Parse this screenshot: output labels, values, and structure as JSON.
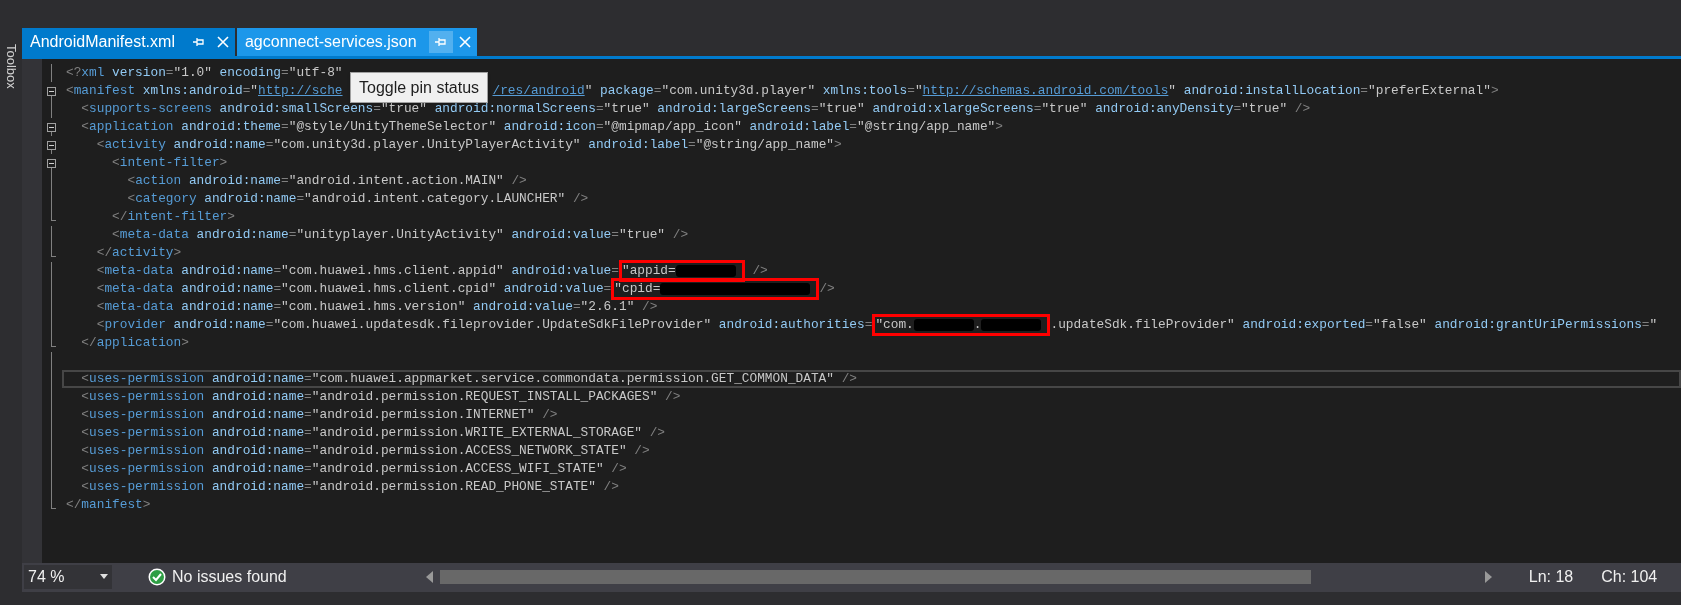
{
  "side_panel": {
    "label": "Toolbox"
  },
  "tabs": [
    {
      "label": "AndroidManifest.xml",
      "selected": true,
      "hovered": false
    },
    {
      "label": "agconnect-services.json",
      "selected": false,
      "hovered": true
    }
  ],
  "tooltip": {
    "text": "Toggle pin status"
  },
  "editor": {
    "lines": [
      {
        "expanded": false,
        "block_end": false,
        "tokens": [
          {
            "kind": "p",
            "text": "<?"
          },
          {
            "kind": "tag",
            "text": "xml"
          },
          {
            "kind": "attr",
            "text": " version"
          },
          {
            "kind": "p",
            "text": "="
          },
          {
            "kind": "val",
            "text": "\"1.0\""
          },
          {
            "kind": "attr",
            "text": " encoding"
          },
          {
            "kind": "p",
            "text": "="
          },
          {
            "kind": "val",
            "text": "\"utf-8\""
          }
        ]
      },
      {
        "expanded": true,
        "block_end": false,
        "tokens": [
          {
            "kind": "p",
            "text": "<"
          },
          {
            "kind": "tag",
            "text": "manifest"
          },
          {
            "kind": "attr",
            "text": " xmlns:android"
          },
          {
            "kind": "p",
            "text": "="
          },
          {
            "kind": "val",
            "text": "\""
          },
          {
            "kind": "link",
            "text": "http://sche"
          },
          {
            "kind": "covered"
          },
          {
            "kind": "link",
            "text": "/res/android"
          },
          {
            "kind": "val",
            "text": "\""
          },
          {
            "kind": "attr",
            "text": " package"
          },
          {
            "kind": "p",
            "text": "="
          },
          {
            "kind": "val",
            "text": "\"com.unity3d.player\""
          },
          {
            "kind": "attr",
            "text": " xmlns:tools"
          },
          {
            "kind": "p",
            "text": "="
          },
          {
            "kind": "val",
            "text": "\""
          },
          {
            "kind": "link",
            "text": "http://schemas.android.com/tools"
          },
          {
            "kind": "val",
            "text": "\""
          },
          {
            "kind": "attr",
            "text": " android:installLocation"
          },
          {
            "kind": "p",
            "text": "="
          },
          {
            "kind": "val",
            "text": "\"preferExternal\""
          },
          {
            "kind": "p",
            "text": ">"
          }
        ]
      },
      {
        "expanded": false,
        "block_end": false,
        "tokens": [
          {
            "kind": "p",
            "text": "  <"
          },
          {
            "kind": "tag",
            "text": "supports-screens"
          },
          {
            "kind": "attr",
            "text": " android:smallScreens"
          },
          {
            "kind": "p",
            "text": "="
          },
          {
            "kind": "val",
            "text": "\"true\""
          },
          {
            "kind": "attr",
            "text": " android:normalScreens"
          },
          {
            "kind": "p",
            "text": "="
          },
          {
            "kind": "val",
            "text": "\"true\""
          },
          {
            "kind": "attr",
            "text": " android:largeScreens"
          },
          {
            "kind": "p",
            "text": "="
          },
          {
            "kind": "val",
            "text": "\"true\""
          },
          {
            "kind": "attr",
            "text": " android:xlargeScreens"
          },
          {
            "kind": "p",
            "text": "="
          },
          {
            "kind": "val",
            "text": "\"true\""
          },
          {
            "kind": "attr",
            "text": " android:anyDensity"
          },
          {
            "kind": "p",
            "text": "="
          },
          {
            "kind": "val",
            "text": "\"true\""
          },
          {
            "kind": "p",
            "text": " />"
          }
        ]
      },
      {
        "expanded": true,
        "block_end": false,
        "tokens": [
          {
            "kind": "p",
            "text": "  <"
          },
          {
            "kind": "tag",
            "text": "application"
          },
          {
            "kind": "attr",
            "text": " android:theme"
          },
          {
            "kind": "p",
            "text": "="
          },
          {
            "kind": "val",
            "text": "\"@style/UnityThemeSelector\""
          },
          {
            "kind": "attr",
            "text": " android:icon"
          },
          {
            "kind": "p",
            "text": "="
          },
          {
            "kind": "val",
            "text": "\"@mipmap/app_icon\""
          },
          {
            "kind": "attr",
            "text": " android:label"
          },
          {
            "kind": "p",
            "text": "="
          },
          {
            "kind": "val",
            "text": "\"@string/app_name\""
          },
          {
            "kind": "p",
            "text": ">"
          }
        ]
      },
      {
        "expanded": true,
        "block_end": false,
        "tokens": [
          {
            "kind": "p",
            "text": "    <"
          },
          {
            "kind": "tag",
            "text": "activity"
          },
          {
            "kind": "attr",
            "text": " android:name"
          },
          {
            "kind": "p",
            "text": "="
          },
          {
            "kind": "val",
            "text": "\"com.unity3d.player.UnityPlayerActivity\""
          },
          {
            "kind": "attr",
            "text": " android:label"
          },
          {
            "kind": "p",
            "text": "="
          },
          {
            "kind": "val",
            "text": "\"@string/app_name\""
          },
          {
            "kind": "p",
            "text": ">"
          }
        ]
      },
      {
        "expanded": true,
        "block_end": false,
        "tokens": [
          {
            "kind": "p",
            "text": "      <"
          },
          {
            "kind": "tag",
            "text": "intent-filter"
          },
          {
            "kind": "p",
            "text": ">"
          }
        ]
      },
      {
        "expanded": false,
        "block_end": false,
        "tokens": [
          {
            "kind": "p",
            "text": "        <"
          },
          {
            "kind": "tag",
            "text": "action"
          },
          {
            "kind": "attr",
            "text": " android:name"
          },
          {
            "kind": "p",
            "text": "="
          },
          {
            "kind": "val",
            "text": "\"android.intent.action.MAIN\""
          },
          {
            "kind": "p",
            "text": " />"
          }
        ]
      },
      {
        "expanded": false,
        "block_end": false,
        "tokens": [
          {
            "kind": "p",
            "text": "        <"
          },
          {
            "kind": "tag",
            "text": "category"
          },
          {
            "kind": "attr",
            "text": " android:name"
          },
          {
            "kind": "p",
            "text": "="
          },
          {
            "kind": "val",
            "text": "\"android.intent.category.LAUNCHER\""
          },
          {
            "kind": "p",
            "text": " />"
          }
        ]
      },
      {
        "expanded": false,
        "block_end": true,
        "tokens": [
          {
            "kind": "p",
            "text": "      </"
          },
          {
            "kind": "tag",
            "text": "intent-filter"
          },
          {
            "kind": "p",
            "text": ">"
          }
        ]
      },
      {
        "expanded": false,
        "block_end": false,
        "tokens": [
          {
            "kind": "p",
            "text": "      <"
          },
          {
            "kind": "tag",
            "text": "meta-data"
          },
          {
            "kind": "attr",
            "text": " android:name"
          },
          {
            "kind": "p",
            "text": "="
          },
          {
            "kind": "val",
            "text": "\"unityplayer.UnityActivity\""
          },
          {
            "kind": "attr",
            "text": " android:value"
          },
          {
            "kind": "p",
            "text": "="
          },
          {
            "kind": "val",
            "text": "\"true\""
          },
          {
            "kind": "p",
            "text": " />"
          }
        ]
      },
      {
        "expanded": false,
        "block_end": true,
        "tokens": [
          {
            "kind": "p",
            "text": "    </"
          },
          {
            "kind": "tag",
            "text": "activity"
          },
          {
            "kind": "p",
            "text": ">"
          }
        ]
      },
      {
        "expanded": false,
        "block_end": false,
        "tokens": [
          {
            "kind": "p",
            "text": "    <"
          },
          {
            "kind": "tag",
            "text": "meta-data"
          },
          {
            "kind": "attr",
            "text": " android:name"
          },
          {
            "kind": "p",
            "text": "="
          },
          {
            "kind": "val",
            "text": "\"com.huawei.hms.client.appid\""
          },
          {
            "kind": "attr",
            "text": " android:value"
          },
          {
            "kind": "p",
            "text": "="
          },
          {
            "kind": "frame",
            "parts": [
              {
                "kind": "val",
                "text": "\"appid="
              },
              {
                "kind": "redacted"
              }
            ]
          },
          {
            "kind": "p",
            "text": " />"
          }
        ]
      },
      {
        "expanded": false,
        "block_end": false,
        "tokens": [
          {
            "kind": "p",
            "text": "    <"
          },
          {
            "kind": "tag",
            "text": "meta-data"
          },
          {
            "kind": "attr",
            "text": " android:name"
          },
          {
            "kind": "p",
            "text": "="
          },
          {
            "kind": "val",
            "text": "\"com.huawei.hms.client.cpid\""
          },
          {
            "kind": "attr",
            "text": " android:value"
          },
          {
            "kind": "p",
            "text": "="
          },
          {
            "kind": "frame",
            "parts": [
              {
                "kind": "val",
                "text": "\"cpid="
              },
              {
                "kind": "redacted_long"
              }
            ]
          },
          {
            "kind": "p",
            "text": "/>"
          }
        ]
      },
      {
        "expanded": false,
        "block_end": false,
        "tokens": [
          {
            "kind": "p",
            "text": "    <"
          },
          {
            "kind": "tag",
            "text": "meta-data"
          },
          {
            "kind": "attr",
            "text": " android:name"
          },
          {
            "kind": "p",
            "text": "="
          },
          {
            "kind": "val",
            "text": "\"com.huawei.hms.version\""
          },
          {
            "kind": "attr",
            "text": " android:value"
          },
          {
            "kind": "p",
            "text": "="
          },
          {
            "kind": "val",
            "text": "\"2.6.1\""
          },
          {
            "kind": "p",
            "text": " />"
          }
        ]
      },
      {
        "expanded": false,
        "block_end": false,
        "tokens": [
          {
            "kind": "p",
            "text": "    <"
          },
          {
            "kind": "tag",
            "text": "provider"
          },
          {
            "kind": "attr",
            "text": " android:name"
          },
          {
            "kind": "p",
            "text": "="
          },
          {
            "kind": "val",
            "text": "\"com.huawei.updatesdk.fileprovider.UpdateSdkFileProvider\""
          },
          {
            "kind": "attr",
            "text": " android:authorities"
          },
          {
            "kind": "p",
            "text": "="
          },
          {
            "kind": "frame",
            "parts": [
              {
                "kind": "val",
                "text": "\"com."
              },
              {
                "kind": "redacted"
              },
              {
                "kind": "val",
                "text": "."
              },
              {
                "kind": "redacted"
              }
            ]
          },
          {
            "kind": "val",
            "text": ".updateSdk.fileProvider\""
          },
          {
            "kind": "attr",
            "text": " android:exported"
          },
          {
            "kind": "p",
            "text": "="
          },
          {
            "kind": "val",
            "text": "\"false\""
          },
          {
            "kind": "attr",
            "text": " android:grantUriPermissions"
          },
          {
            "kind": "p",
            "text": "="
          },
          {
            "kind": "val",
            "text": "\""
          }
        ]
      },
      {
        "expanded": false,
        "block_end": true,
        "tokens": [
          {
            "kind": "p",
            "text": "  </"
          },
          {
            "kind": "tag",
            "text": "application"
          },
          {
            "kind": "p",
            "text": ">"
          }
        ]
      },
      {
        "expanded": false,
        "block_end": false
      },
      {
        "expanded": false,
        "block_end": false,
        "current": true,
        "tokens": [
          {
            "kind": "p",
            "text": "  <"
          },
          {
            "kind": "tag",
            "text": "uses-permission"
          },
          {
            "kind": "attr",
            "text": " android:name"
          },
          {
            "kind": "p",
            "text": "="
          },
          {
            "kind": "val",
            "text": "\"com.huawei.appmarket.service.commondata.permission.GET_COMMON_DATA\""
          },
          {
            "kind": "p",
            "text": " />"
          }
        ]
      },
      {
        "expanded": false,
        "block_end": false,
        "tokens": [
          {
            "kind": "p",
            "text": "  <"
          },
          {
            "kind": "tag",
            "text": "uses-permission"
          },
          {
            "kind": "attr",
            "text": " android:name"
          },
          {
            "kind": "p",
            "text": "="
          },
          {
            "kind": "val",
            "text": "\"android.permission.REQUEST_INSTALL_PACKAGES\""
          },
          {
            "kind": "p",
            "text": " />"
          }
        ]
      },
      {
        "expanded": false,
        "block_end": false,
        "tokens": [
          {
            "kind": "p",
            "text": "  <"
          },
          {
            "kind": "tag",
            "text": "uses-permission"
          },
          {
            "kind": "attr",
            "text": " android:name"
          },
          {
            "kind": "p",
            "text": "="
          },
          {
            "kind": "val",
            "text": "\"android.permission.INTERNET\""
          },
          {
            "kind": "p",
            "text": " />"
          }
        ]
      },
      {
        "expanded": false,
        "block_end": false,
        "tokens": [
          {
            "kind": "p",
            "text": "  <"
          },
          {
            "kind": "tag",
            "text": "uses-permission"
          },
          {
            "kind": "attr",
            "text": " android:name"
          },
          {
            "kind": "p",
            "text": "="
          },
          {
            "kind": "val",
            "text": "\"android.permission.WRITE_EXTERNAL_STORAGE\""
          },
          {
            "kind": "p",
            "text": " />"
          }
        ]
      },
      {
        "expanded": false,
        "block_end": false,
        "tokens": [
          {
            "kind": "p",
            "text": "  <"
          },
          {
            "kind": "tag",
            "text": "uses-permission"
          },
          {
            "kind": "attr",
            "text": " android:name"
          },
          {
            "kind": "p",
            "text": "="
          },
          {
            "kind": "val",
            "text": "\"android.permission.ACCESS_NETWORK_STATE\""
          },
          {
            "kind": "p",
            "text": " />"
          }
        ]
      },
      {
        "expanded": false,
        "block_end": false,
        "tokens": [
          {
            "kind": "p",
            "text": "  <"
          },
          {
            "kind": "tag",
            "text": "uses-permission"
          },
          {
            "kind": "attr",
            "text": " android:name"
          },
          {
            "kind": "p",
            "text": "="
          },
          {
            "kind": "val",
            "text": "\"android.permission.ACCESS_WIFI_STATE\""
          },
          {
            "kind": "p",
            "text": " />"
          }
        ]
      },
      {
        "expanded": false,
        "block_end": false,
        "tokens": [
          {
            "kind": "p",
            "text": "  <"
          },
          {
            "kind": "tag",
            "text": "uses-permission"
          },
          {
            "kind": "attr",
            "text": " android:name"
          },
          {
            "kind": "p",
            "text": "="
          },
          {
            "kind": "val",
            "text": "\"android.permission.READ_PHONE_STATE\""
          },
          {
            "kind": "p",
            "text": " />"
          }
        ]
      },
      {
        "expanded": false,
        "block_end": true,
        "tokens": [
          {
            "kind": "p",
            "text": "</"
          },
          {
            "kind": "tag",
            "text": "manifest"
          },
          {
            "kind": "p",
            "text": ">"
          }
        ]
      }
    ]
  },
  "status_bar": {
    "zoom": "74 %",
    "issues": "No issues found",
    "line": "Ln: 18",
    "column": "Ch: 104"
  }
}
